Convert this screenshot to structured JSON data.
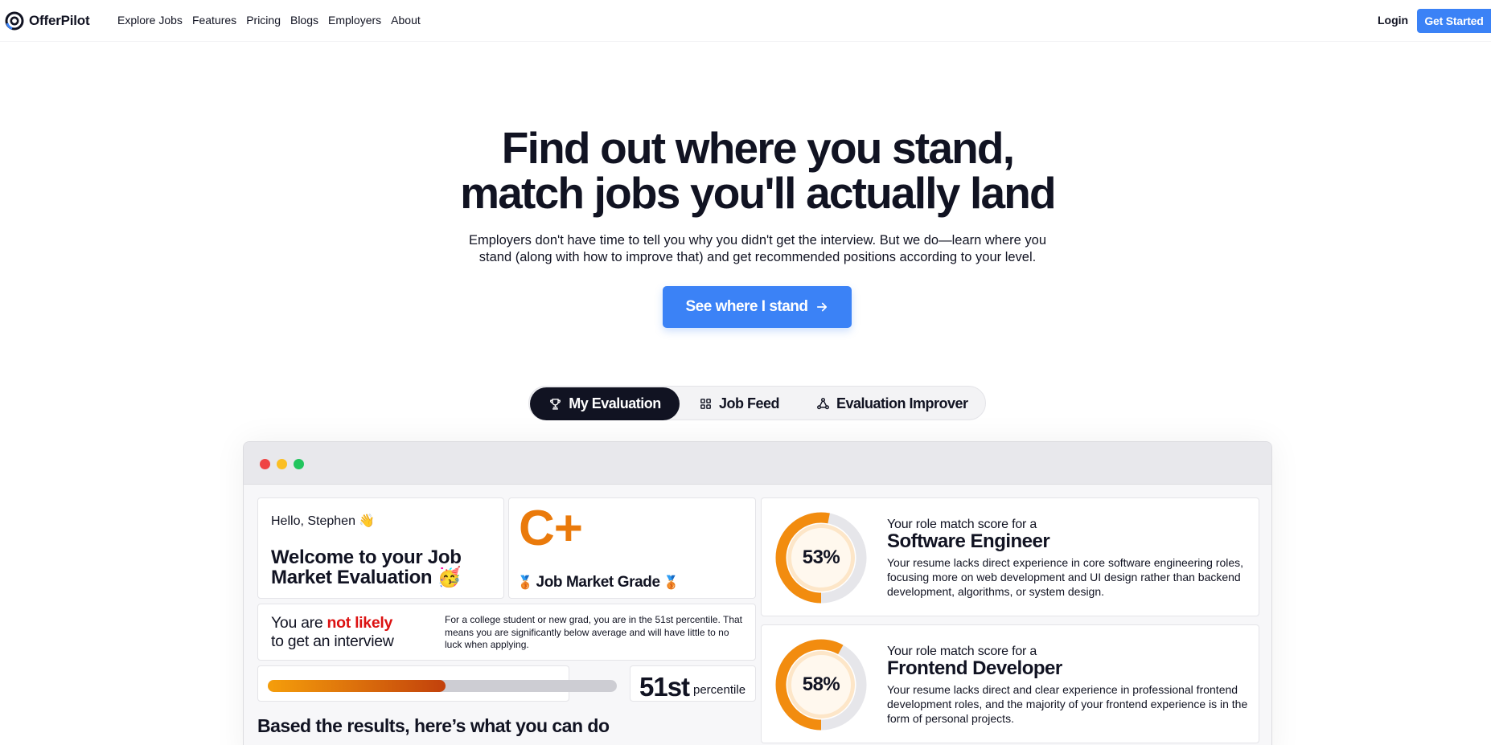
{
  "nav": {
    "brand": "OfferPilot",
    "links": [
      "Explore Jobs",
      "Features",
      "Pricing",
      "Blogs",
      "Employers",
      "About"
    ],
    "login": "Login",
    "get_started": "Get Started"
  },
  "hero": {
    "title_line1": "Find out where you stand,",
    "title_line2": "match jobs you'll actually land",
    "subtitle": "Employers don't have time to tell you why you didn't get the interview. But we do—learn where you stand (along with how to improve that) and get recommended positions according to your level.",
    "cta": "See where I stand"
  },
  "tabs": [
    {
      "label": "My Evaluation",
      "icon": "trophy-icon",
      "active": true
    },
    {
      "label": "Job Feed",
      "icon": "grid-icon",
      "active": false
    },
    {
      "label": "Evaluation Improver",
      "icon": "network-icon",
      "active": false
    }
  ],
  "evaluation": {
    "hello": "Hello, Stephen 👋",
    "welcome": "Welcome to your Job Market Evaluation 🥳",
    "grade": "C+",
    "grade_label": "Job Market Grade",
    "grade_medal": "🥉",
    "likely_prefix": "You are ",
    "likely_highlight": "not likely",
    "likely_suffix": "to get an interview",
    "likely_note": "For a college student or new grad, you are in the 51st percentile. That means you are significantly below average and will have little to no luck when applying.",
    "percentile_value": 51,
    "percentile_number": "51st",
    "percentile_label": "percentile",
    "based_heading": "Based the results, here’s what you can do"
  },
  "roles": [
    {
      "score": 53,
      "score_text": "53%",
      "prefix": "Your role match score for a",
      "name": "Software Engineer",
      "description": "Your resume lacks direct experience in core software engineering roles, focusing more on web development and UI design rather than backend development, algorithms, or system design."
    },
    {
      "score": 58,
      "score_text": "58%",
      "prefix": "Your role match score for a",
      "name": "Frontend Developer",
      "description": "Your resume lacks direct and clear experience in professional frontend development roles, and the majority of your frontend experience is in the form of personal projects."
    }
  ],
  "colors": {
    "primary_blue": "#3b82f6",
    "dark": "#111322",
    "orange": "#ea7a0b",
    "red": "#dc1111"
  }
}
